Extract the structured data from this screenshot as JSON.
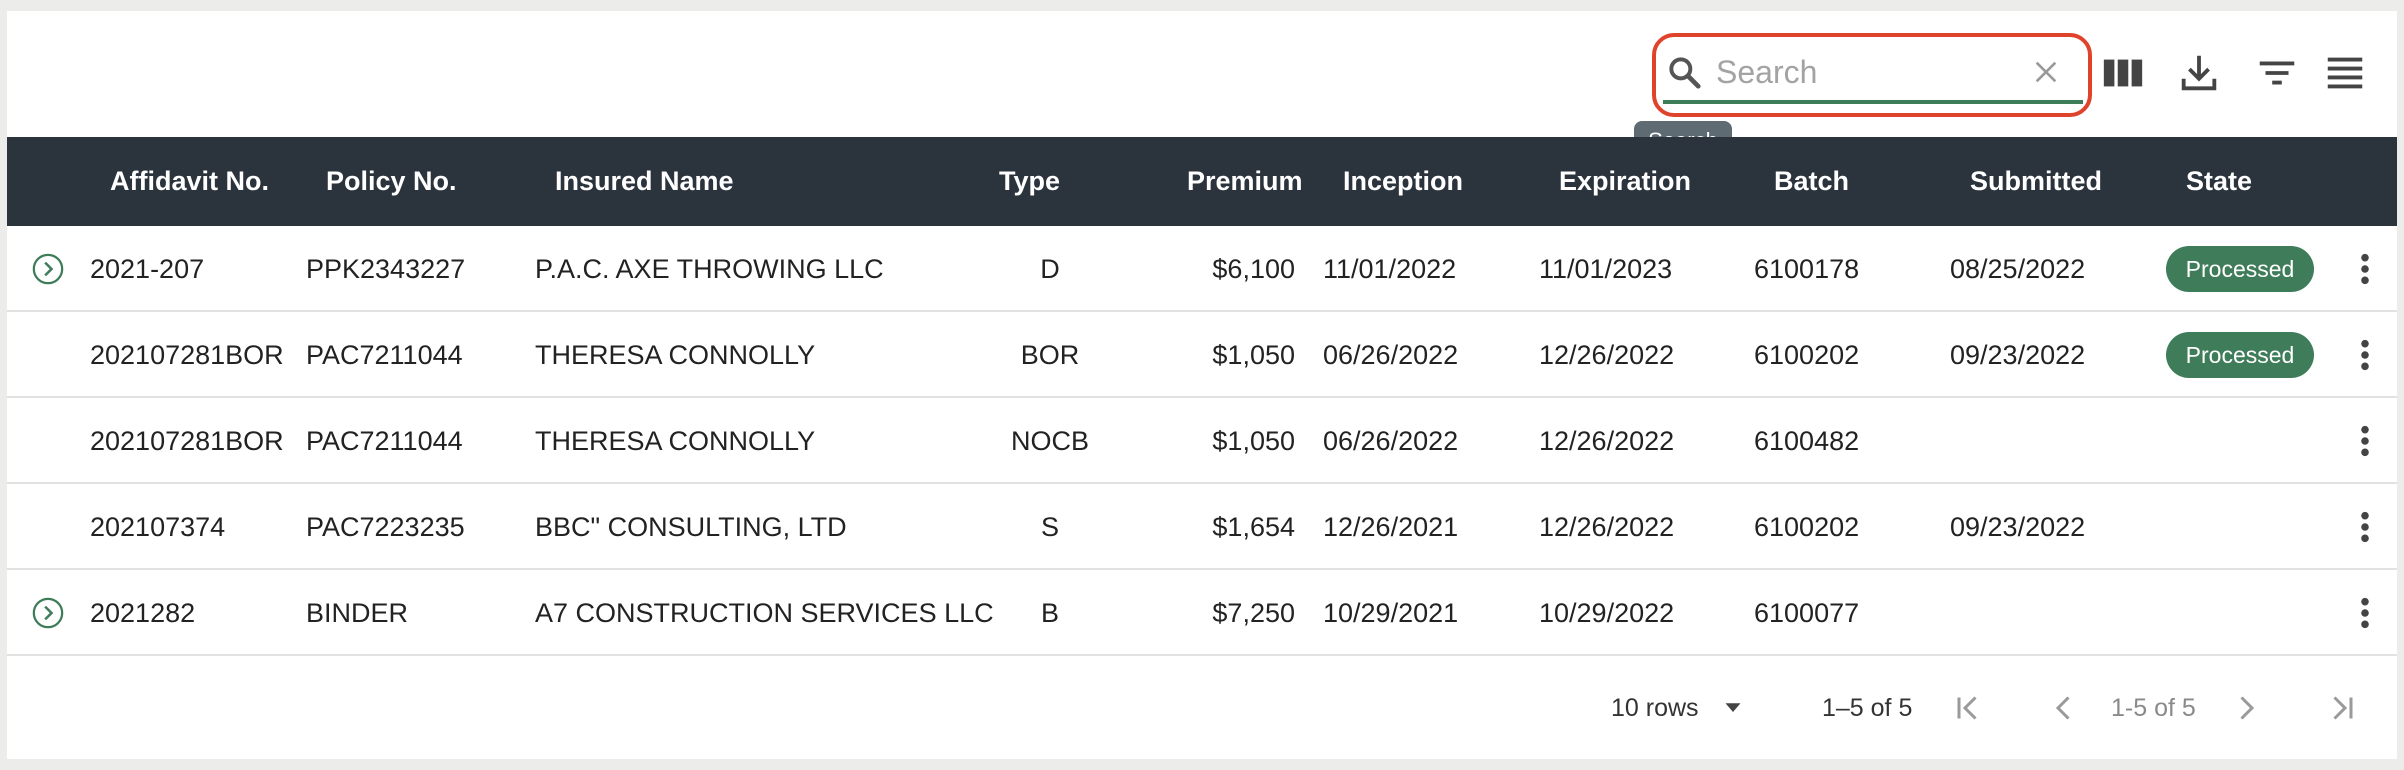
{
  "toolbar": {
    "search_placeholder": "Search",
    "search_value": "",
    "tooltip": "Search",
    "icons": [
      "columns-icon",
      "download-icon",
      "filter-icon",
      "density-icon"
    ]
  },
  "table": {
    "columns": [
      "Affidavit No.",
      "Policy No.",
      "Insured Name",
      "Type",
      "Premium",
      "Inception",
      "Expiration",
      "Batch",
      "Submitted",
      "State"
    ],
    "rows": [
      {
        "affidavit": "2021-207",
        "policy": "PPK2343227",
        "insured": "P.A.C. AXE THROWING LLC",
        "type": "D",
        "premium": "$6,100",
        "inception": "11/01/2022",
        "expiration": "11/01/2023",
        "batch": "6100178",
        "submitted": "08/25/2022",
        "state": "Processed",
        "expandable": true
      },
      {
        "affidavit": "202107281BOR",
        "policy": "PAC7211044",
        "insured": "THERESA CONNOLLY",
        "type": "BOR",
        "premium": "$1,050",
        "inception": "06/26/2022",
        "expiration": "12/26/2022",
        "batch": "6100202",
        "submitted": "09/23/2022",
        "state": "Processed",
        "expandable": false
      },
      {
        "affidavit": "202107281BOR",
        "policy": "PAC7211044",
        "insured": "THERESA CONNOLLY",
        "type": "NOCB",
        "premium": "$1,050",
        "inception": "06/26/2022",
        "expiration": "12/26/2022",
        "batch": "6100482",
        "submitted": "",
        "state": "",
        "expandable": false
      },
      {
        "affidavit": "202107374",
        "policy": "PAC7223235",
        "insured": "BBC\" CONSULTING, LTD",
        "type": "S",
        "premium": "$1,654",
        "inception": "12/26/2021",
        "expiration": "12/26/2022",
        "batch": "6100202",
        "submitted": "09/23/2022",
        "state": "",
        "expandable": false
      },
      {
        "affidavit": "2021282",
        "policy": "BINDER",
        "insured": "A7 CONSTRUCTION SERVICES LLC",
        "type": "B",
        "premium": "$7,250",
        "inception": "10/29/2021",
        "expiration": "10/29/2022",
        "batch": "6100077",
        "submitted": "",
        "state": "",
        "expandable": true
      }
    ]
  },
  "footer": {
    "rows_per_page": "10 rows",
    "range": "1–5 of 5",
    "page_info": "1-5 of 5"
  },
  "colors": {
    "header_bg": "#2b333d",
    "accent": "#3f7d5a",
    "highlight": "#e0432c"
  }
}
